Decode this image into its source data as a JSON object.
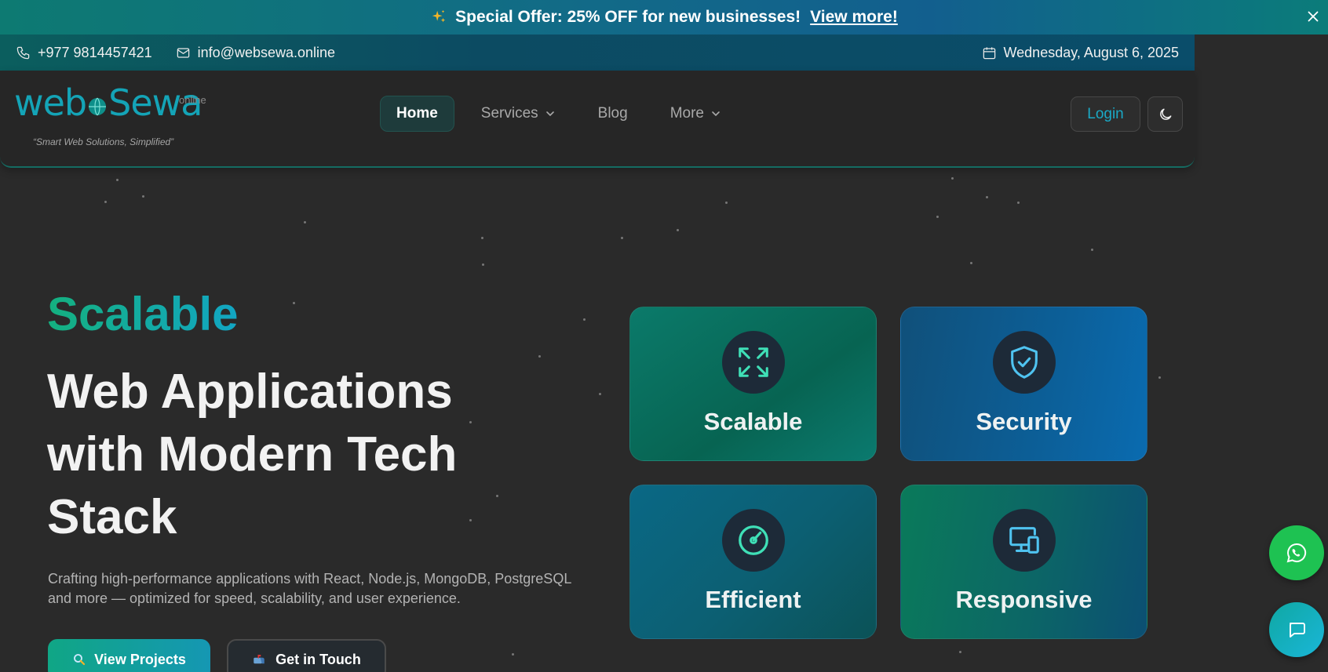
{
  "announcement": {
    "icon": "sparkles-icon",
    "prefix": "Special Offer: ",
    "highlight": "25% OFF",
    "suffix": " for new businesses!",
    "link_label": "View more!"
  },
  "contact": {
    "phone": "+977 9814457421",
    "email": "info@websewa.online",
    "date": "Wednesday, August 6, 2025"
  },
  "brand": {
    "name_part1": "web",
    "name_part2": "Sewa",
    "suffix": "online",
    "tagline": "“Smart Web Solutions, Simplified”"
  },
  "nav": {
    "items": [
      {
        "label": "Home",
        "active": true,
        "dropdown": false
      },
      {
        "label": "Services",
        "active": false,
        "dropdown": true
      },
      {
        "label": "Blog",
        "active": false,
        "dropdown": false
      },
      {
        "label": "More",
        "active": false,
        "dropdown": true
      }
    ],
    "login_label": "Login",
    "theme_toggle_icon": "moon-icon"
  },
  "hero": {
    "accent_word": "Scalable",
    "title": "Web Applications with Modern Tech Stack",
    "description": "Crafting high-performance applications with React, Node.js, MongoDB, PostgreSQL and more — optimized for speed, scalability, and user experience.",
    "primary_button": "View Projects",
    "secondary_button": "Get in Touch"
  },
  "features": [
    {
      "label": "Scalable",
      "icon": "expand-arrows-icon"
    },
    {
      "label": "Security",
      "icon": "shield-check-icon"
    },
    {
      "label": "Efficient",
      "icon": "gauge-icon"
    },
    {
      "label": "Responsive",
      "icon": "devices-icon"
    }
  ],
  "colors": {
    "accent_teal": "#14b07f",
    "accent_cyan": "#12a6c4",
    "whatsapp_green": "#1ec252",
    "background": "#2a2a2a"
  }
}
